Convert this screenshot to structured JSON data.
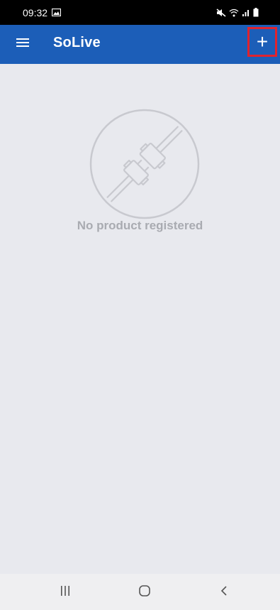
{
  "status_bar": {
    "time": "09:32",
    "icons": [
      "gallery-icon",
      "mute-icon",
      "wifi-icon",
      "signal-icon",
      "battery-icon"
    ]
  },
  "app_bar": {
    "title": "SoLive",
    "menu_icon": "hamburger-menu-icon",
    "add_icon": "plus-icon",
    "add_label": "+",
    "background_color": "#1c5eb8",
    "highlight_color": "#e0232e"
  },
  "empty_state": {
    "icon": "plug-icon",
    "message": "No product registered"
  },
  "nav_bar": {
    "buttons": [
      "recent-apps-icon",
      "home-icon",
      "back-icon"
    ]
  }
}
